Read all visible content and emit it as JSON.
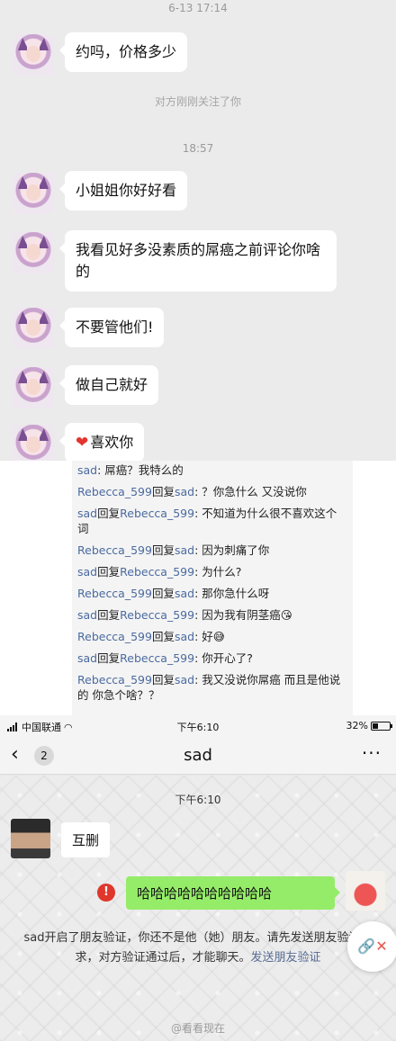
{
  "chat": {
    "timestamp1": "6-13 17:14",
    "timestamp2": "18:57",
    "system_notice": "对方刚刚关注了你",
    "messages": [
      "约吗，价格多少",
      "小姐姐你好好看",
      "我看见好多没素质的屌癌之前评论你啥的",
      "不要管他们!",
      "做自己就好",
      "喜欢你"
    ],
    "avatar_icon": "anime-girl-avatar-icon",
    "heart_icon": "red-heart-icon"
  },
  "comments": [
    {
      "from": "sad",
      "reply_word": "",
      "to": "",
      "text": ": 屌癌？我特么的"
    },
    {
      "from": "Rebecca_599",
      "reply_word": "回复",
      "to": "sad",
      "text": ": ？你急什么 又没说你"
    },
    {
      "from": "sad",
      "reply_word": "回复",
      "to": "Rebecca_599",
      "text": ": 不知道为什么很不喜欢这个词"
    },
    {
      "from": "Rebecca_599",
      "reply_word": "回复",
      "to": "sad",
      "text": ": 因为刺痛了你"
    },
    {
      "from": "sad",
      "reply_word": "回复",
      "to": "Rebecca_599",
      "text": ": 为什么?"
    },
    {
      "from": "Rebecca_599",
      "reply_word": "回复",
      "to": "sad",
      "text": ": 那你急什么呀"
    },
    {
      "from": "sad",
      "reply_word": "回复",
      "to": "Rebecca_599",
      "text": ": 因为我有阴茎癌😘"
    },
    {
      "from": "Rebecca_599",
      "reply_word": "回复",
      "to": "sad",
      "text": ": 好😅"
    },
    {
      "from": "sad",
      "reply_word": "回复",
      "to": "Rebecca_599",
      "text": ": 你开心了?"
    },
    {
      "from": "Rebecca_599",
      "reply_word": "回复",
      "to": "sad",
      "text": ": 我又没说你屌癌 而且是他说的 你急个啥？？"
    }
  ],
  "wechat": {
    "status": {
      "carrier": "中国联通",
      "time": "下午6:10",
      "battery": "32%",
      "battery_level": 0.32
    },
    "nav": {
      "back_icon": "chevron-left-icon",
      "unread_count": "2",
      "title": "sad",
      "more_icon": "more-dots-icon"
    },
    "timestamp": "下午6:10",
    "incoming": "互删",
    "outgoing": "哈哈哈哈哈哈哈哈哈哈",
    "error_icon": "exclamation-error-icon",
    "system_text": "sad开启了朋友验证，你还不是他（她）朋友。请先发送朋友验证请求，对方验证通过后，才能聊天。",
    "system_link": "发送朋友验证",
    "watermark": "@看看现在"
  },
  "colors": {
    "wechat_green": "#95ec69",
    "link_blue": "#576b95",
    "error_red": "#e0362c"
  }
}
